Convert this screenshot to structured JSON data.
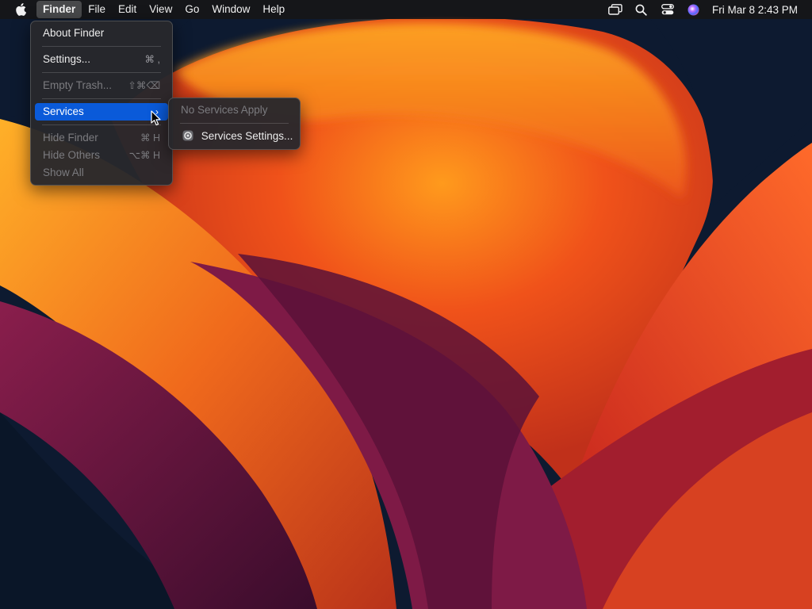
{
  "menubar": {
    "apple": "apple-logo-icon",
    "items": [
      "Finder",
      "File",
      "Edit",
      "View",
      "Go",
      "Window",
      "Help"
    ],
    "active_index": 0,
    "status_icons": [
      "screen-mirroring-icon",
      "spotlight-search-icon",
      "control-center-icon",
      "siri-icon"
    ],
    "clock": "Fri Mar 8  2:43 PM"
  },
  "finder_menu": {
    "about": "About Finder",
    "settings": {
      "label": "Settings...",
      "shortcut": "⌘ ,"
    },
    "empty_trash": {
      "label": "Empty Trash...",
      "shortcut": "⇧⌘⌫"
    },
    "services": {
      "label": "Services",
      "chevron": "›"
    },
    "hide_finder": {
      "label": "Hide Finder",
      "shortcut": "⌘ H"
    },
    "hide_others": {
      "label": "Hide Others",
      "shortcut": "⌥⌘ H"
    },
    "show_all": {
      "label": "Show All"
    }
  },
  "services_menu": {
    "none": "No Services Apply",
    "settings": "Services Settings..."
  },
  "colors": {
    "highlight": "#0a5ad9",
    "menu_bg": "#28282c",
    "disabled_text": "#7b7b7f"
  }
}
